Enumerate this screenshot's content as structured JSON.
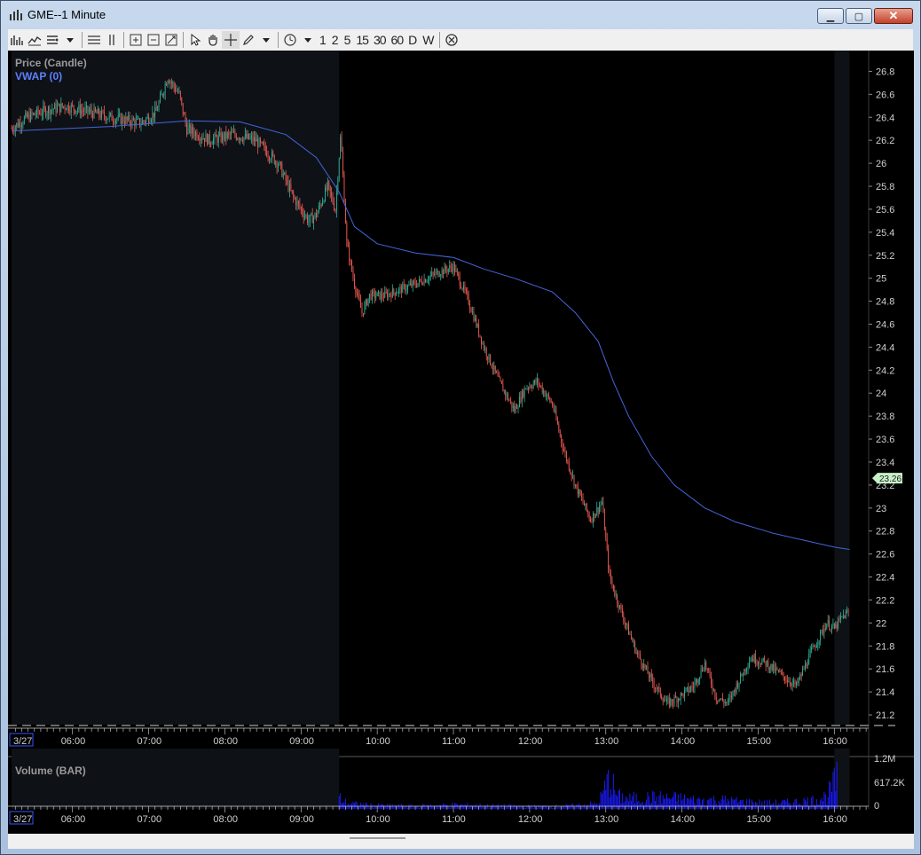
{
  "window": {
    "title": "GME--1 Minute",
    "minimize_label": "▁",
    "maximize_label": "▢",
    "close_label": "✕"
  },
  "toolbar": {
    "intervals": [
      "1",
      "2",
      "5",
      "15",
      "30",
      "60",
      "D",
      "W"
    ],
    "icons": [
      "bar-chart-icon",
      "line-chart-icon",
      "drawing-menu-icon",
      "dropdown-icon",
      "horizontal-lines-icon",
      "vertical-lines-icon",
      "zoom-in-icon",
      "zoom-out-icon",
      "zoom-fit-icon",
      "cursor-icon",
      "pan-hand-icon",
      "crosshair-icon",
      "pencil-icon",
      "dropdown-icon",
      "clock-icon",
      "dropdown-icon",
      "cancel-icon"
    ]
  },
  "colors": {
    "up_candle": "#2fb59a",
    "down_candle": "#f25c54",
    "vwap_line": "#4466dd",
    "volume_bar": "#1a1aff",
    "premarket_shade": "#0e1116",
    "price_tag_bg": "#c8f0c8"
  },
  "chart_data": [
    {
      "type": "candlestick",
      "title": "Price (Candle)",
      "legend": [
        "Price (Candle)",
        "VWAP (0)"
      ],
      "x_ticks": [
        "3/27",
        "06:00",
        "07:00",
        "08:00",
        "09:00",
        "10:00",
        "11:00",
        "12:00",
        "13:00",
        "14:00",
        "15:00",
        "16:00"
      ],
      "y_ticks": [
        "26.8",
        "26.6",
        "26.4",
        "26.2",
        "26",
        "25.8",
        "25.6",
        "25.4",
        "25.2",
        "25",
        "24.8",
        "24.6",
        "24.4",
        "24.2",
        "24",
        "23.8",
        "23.6",
        "23.4",
        "23.2",
        "23",
        "22.8",
        "22.6",
        "22.4",
        "22.2",
        "22",
        "21.8",
        "21.6",
        "21.4",
        "21.2"
      ],
      "ylim": [
        21.1,
        26.95
      ],
      "xlim_hours": [
        5.2,
        16.45
      ],
      "shaded_sessions": [
        [
          5.2,
          9.5
        ],
        [
          16.0,
          16.2
        ]
      ],
      "last_price_label": "23.26",
      "last_price_value": 23.26,
      "price_path": [
        [
          5.2,
          26.3
        ],
        [
          5.4,
          26.4
        ],
        [
          5.6,
          26.45
        ],
        [
          5.9,
          26.5
        ],
        [
          6.2,
          26.45
        ],
        [
          6.5,
          26.4
        ],
        [
          6.9,
          26.35
        ],
        [
          7.1,
          26.45
        ],
        [
          7.25,
          26.75
        ],
        [
          7.4,
          26.6
        ],
        [
          7.5,
          26.3
        ],
        [
          7.8,
          26.2
        ],
        [
          8.1,
          26.25
        ],
        [
          8.4,
          26.2
        ],
        [
          8.7,
          26.0
        ],
        [
          8.9,
          25.7
        ],
        [
          9.1,
          25.5
        ],
        [
          9.2,
          25.55
        ],
        [
          9.35,
          25.8
        ],
        [
          9.45,
          25.6
        ],
        [
          9.52,
          26.25
        ],
        [
          9.6,
          25.3
        ],
        [
          9.7,
          24.95
        ],
        [
          9.8,
          24.7
        ],
        [
          9.9,
          24.85
        ],
        [
          10.1,
          24.85
        ],
        [
          10.3,
          24.9
        ],
        [
          10.5,
          24.95
        ],
        [
          10.8,
          25.05
        ],
        [
          11.0,
          25.1
        ],
        [
          11.2,
          24.8
        ],
        [
          11.4,
          24.4
        ],
        [
          11.6,
          24.1
        ],
        [
          11.8,
          23.85
        ],
        [
          11.95,
          24.05
        ],
        [
          12.1,
          24.1
        ],
        [
          12.3,
          23.9
        ],
        [
          12.45,
          23.5
        ],
        [
          12.6,
          23.2
        ],
        [
          12.8,
          22.9
        ],
        [
          12.95,
          23.05
        ],
        [
          13.05,
          22.4
        ],
        [
          13.2,
          22.1
        ],
        [
          13.4,
          21.75
        ],
        [
          13.6,
          21.5
        ],
        [
          13.8,
          21.3
        ],
        [
          13.95,
          21.35
        ],
        [
          14.15,
          21.45
        ],
        [
          14.3,
          21.65
        ],
        [
          14.45,
          21.35
        ],
        [
          14.6,
          21.3
        ],
        [
          14.75,
          21.5
        ],
        [
          14.9,
          21.7
        ],
        [
          15.1,
          21.65
        ],
        [
          15.3,
          21.55
        ],
        [
          15.5,
          21.45
        ],
        [
          15.7,
          21.75
        ],
        [
          15.9,
          22.0
        ],
        [
          16.0,
          21.95
        ],
        [
          16.1,
          22.05
        ],
        [
          16.2,
          22.1
        ]
      ],
      "vwap_path": [
        [
          5.2,
          26.28
        ],
        [
          6.5,
          26.32
        ],
        [
          7.5,
          26.37
        ],
        [
          8.2,
          26.36
        ],
        [
          8.8,
          26.25
        ],
        [
          9.2,
          26.05
        ],
        [
          9.5,
          25.75
        ],
        [
          9.7,
          25.45
        ],
        [
          10.0,
          25.3
        ],
        [
          10.5,
          25.22
        ],
        [
          11.0,
          25.18
        ],
        [
          11.4,
          25.08
        ],
        [
          11.8,
          25.0
        ],
        [
          12.3,
          24.88
        ],
        [
          12.6,
          24.7
        ],
        [
          12.9,
          24.45
        ],
        [
          13.1,
          24.1
        ],
        [
          13.3,
          23.8
        ],
        [
          13.6,
          23.45
        ],
        [
          13.9,
          23.2
        ],
        [
          14.3,
          23.0
        ],
        [
          14.7,
          22.88
        ],
        [
          15.2,
          22.78
        ],
        [
          15.6,
          22.72
        ],
        [
          16.0,
          22.66
        ],
        [
          16.2,
          22.64
        ]
      ]
    },
    {
      "type": "bar",
      "title": "Volume (BAR)",
      "y_ticks": [
        "1.2M",
        "617.2K",
        "0"
      ],
      "ylim": [
        0,
        1200000
      ],
      "x_ticks": [
        "3/27",
        "06:00",
        "07:00",
        "08:00",
        "09:00",
        "10:00",
        "11:00",
        "12:00",
        "13:00",
        "14:00",
        "15:00",
        "16:00"
      ],
      "volume_profile": [
        [
          9.5,
          400000
        ],
        [
          9.6,
          200000
        ],
        [
          9.8,
          150000
        ],
        [
          10.0,
          120000
        ],
        [
          10.5,
          100000
        ],
        [
          11.0,
          140000
        ],
        [
          11.5,
          110000
        ],
        [
          12.0,
          90000
        ],
        [
          12.5,
          100000
        ],
        [
          12.9,
          180000
        ],
        [
          13.05,
          1100000
        ],
        [
          13.15,
          450000
        ],
        [
          13.3,
          350000
        ],
        [
          13.6,
          400000
        ],
        [
          13.9,
          380000
        ],
        [
          14.2,
          300000
        ],
        [
          14.5,
          320000
        ],
        [
          14.8,
          250000
        ],
        [
          15.1,
          200000
        ],
        [
          15.4,
          220000
        ],
        [
          15.7,
          300000
        ],
        [
          15.9,
          450000
        ],
        [
          16.0,
          900000
        ],
        [
          16.05,
          1150000
        ]
      ]
    }
  ]
}
